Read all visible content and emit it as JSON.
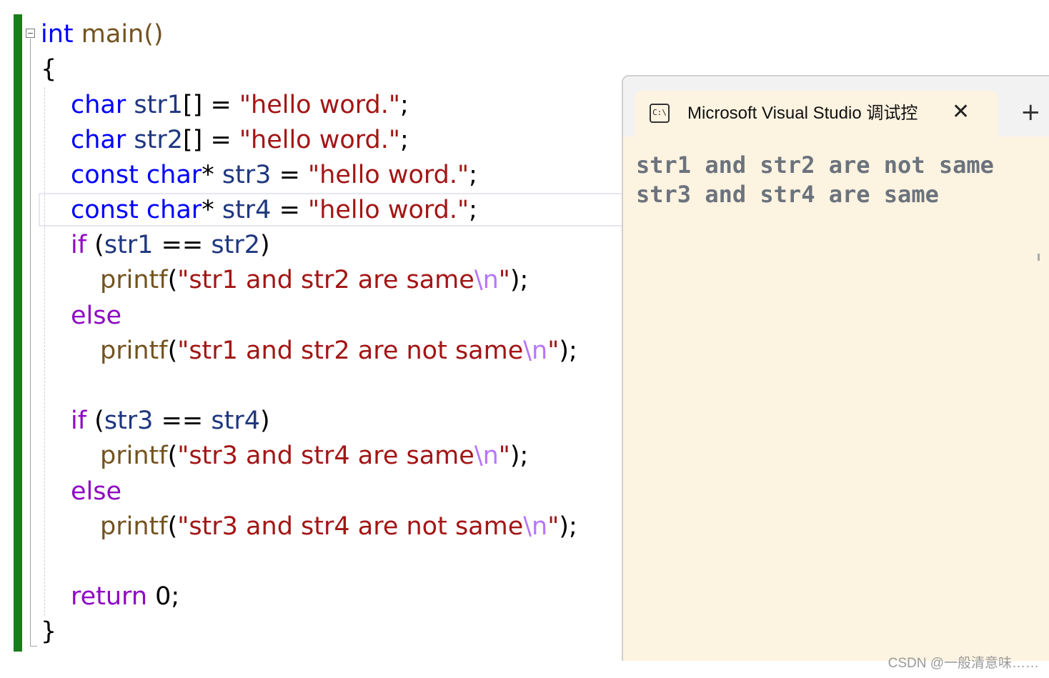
{
  "editor": {
    "line1": {
      "kw": "int",
      "name": "main()"
    },
    "brace_open": "{",
    "decl1": {
      "type": "char",
      "name": "str1",
      "mid": "[] = ",
      "value": "\"hello word.\"",
      "end": ";"
    },
    "decl2": {
      "type": "char",
      "name": "str2",
      "mid": "[] = ",
      "value": "\"hello word.\"",
      "end": ";"
    },
    "decl3": {
      "type": "const char",
      "mid": "* ",
      "name": "str3",
      "eq": " = ",
      "value": "\"hello word.\"",
      "end": ";"
    },
    "decl4": {
      "type": "const char",
      "mid": "* ",
      "name": "str4",
      "eq": " = ",
      "value": "\"hello word.\"",
      "end": ";"
    },
    "if1": {
      "kw": "if",
      "open": " (",
      "a": "str1",
      "op": " == ",
      "b": "str2",
      "close": ")"
    },
    "print1": {
      "fn": "printf",
      "open": "(",
      "text": "\"str1 and str2 are same",
      "esc": "\\n",
      "quote": "\"",
      "close": ");"
    },
    "else1": "else",
    "print2": {
      "fn": "printf",
      "open": "(",
      "text": "\"str1 and str2 are not same",
      "esc": "\\n",
      "quote": "\"",
      "close": ");"
    },
    "if2": {
      "kw": "if",
      "open": " (",
      "a": "str3",
      "op": " == ",
      "b": "str4",
      "close": ")"
    },
    "print3": {
      "fn": "printf",
      "open": "(",
      "text": "\"str3 and str4 are same",
      "esc": "\\n",
      "quote": "\"",
      "close": ");"
    },
    "else2": "else",
    "print4": {
      "fn": "printf",
      "open": "(",
      "text": "\"str3 and str4 are not same",
      "esc": "\\n",
      "quote": "\"",
      "close": ");"
    },
    "ret": {
      "kw": "return",
      "value": " 0;"
    },
    "brace_close": "}"
  },
  "console": {
    "tab_icon": "C:\\",
    "tab_title": "Microsoft Visual Studio 调试控",
    "close_icon": "✕",
    "new_tab_icon": "+",
    "output": [
      "str1 and str2 are not same",
      "str3 and str4 are same"
    ]
  },
  "watermark": "CSDN @一般清意味……",
  "colors": {
    "keyword": "#0000ff",
    "control": "#8f08c4",
    "variable": "#1f377f",
    "function": "#74531f",
    "string": "#a31515",
    "escape": "#b776fb",
    "change_bar": "#1a7d1a",
    "console_bg": "#fdf3e1",
    "console_text": "#6b737d"
  }
}
